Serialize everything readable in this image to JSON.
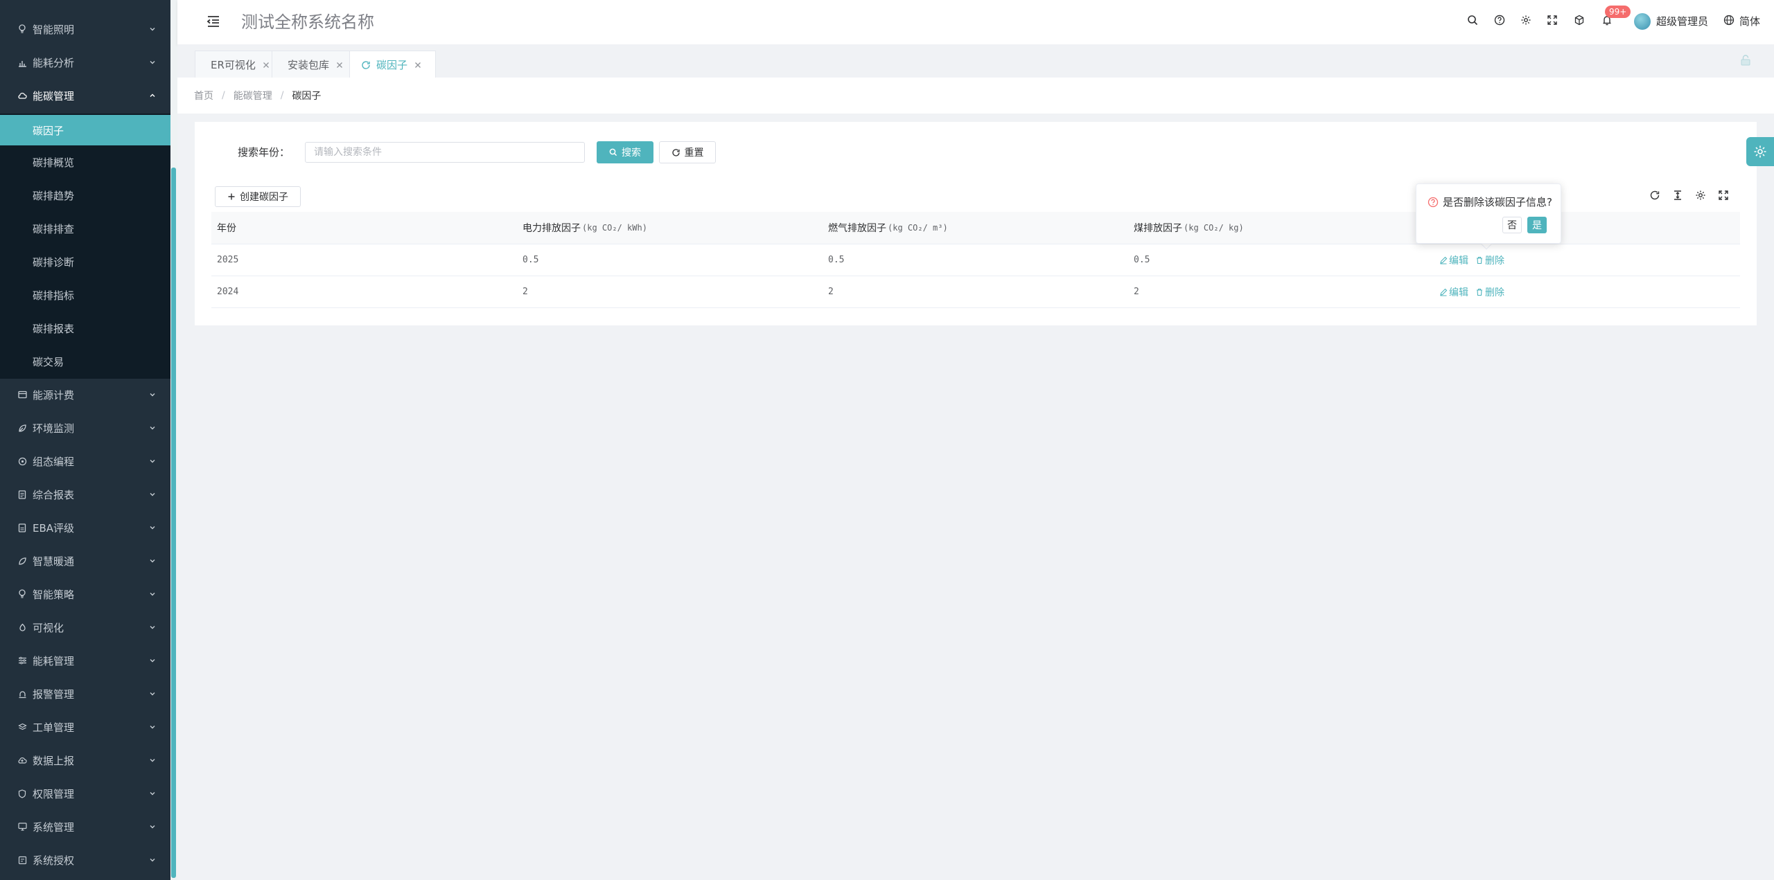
{
  "app": {
    "title": "测试全称系统名称"
  },
  "colors": {
    "primary": "#4fb4bd",
    "sidebar_bg": "#22303c",
    "submenu_bg": "#0f1c26",
    "badge": "#f56c6c"
  },
  "sidebar": {
    "items_top": [
      {
        "label": "智能照明",
        "icon": "bulb-icon"
      },
      {
        "label": "能耗分析",
        "icon": "chart-icon"
      },
      {
        "label": "能碳管理",
        "icon": "cloud-icon",
        "open": true
      }
    ],
    "submenu": [
      {
        "label": "碳因子",
        "active": true
      },
      {
        "label": "碳排概览"
      },
      {
        "label": "碳排趋势"
      },
      {
        "label": "碳排排查"
      },
      {
        "label": "碳排诊断"
      },
      {
        "label": "碳排指标"
      },
      {
        "label": "碳排报表"
      },
      {
        "label": "碳交易"
      }
    ],
    "items_bottom": [
      {
        "label": "能源计费",
        "icon": "billing-icon"
      },
      {
        "label": "环境监测",
        "icon": "leaf-icon"
      },
      {
        "label": "组态编程",
        "icon": "config-icon"
      },
      {
        "label": "综合报表",
        "icon": "report-icon"
      },
      {
        "label": "EBA评级",
        "icon": "rating-icon"
      },
      {
        "label": "智慧暖通",
        "icon": "hvac-icon"
      },
      {
        "label": "智能策略",
        "icon": "strategy-icon"
      },
      {
        "label": "可视化",
        "icon": "visual-icon"
      },
      {
        "label": "能耗管理",
        "icon": "sliders-icon"
      },
      {
        "label": "报警管理",
        "icon": "alarm-icon"
      },
      {
        "label": "工单管理",
        "icon": "layers-icon"
      },
      {
        "label": "数据上报",
        "icon": "upload-icon"
      },
      {
        "label": "权限管理",
        "icon": "shield-icon"
      },
      {
        "label": "系统管理",
        "icon": "monitor-icon"
      },
      {
        "label": "系统授权",
        "icon": "license-icon"
      }
    ]
  },
  "header": {
    "icons": [
      "search-icon",
      "help-icon",
      "gear-icon",
      "fullscreen-icon",
      "box-icon",
      "bell-icon"
    ],
    "badge": "99+",
    "user_name": "超级管理员",
    "language": "简体"
  },
  "tabs": [
    {
      "label": "ER可视化",
      "active": false
    },
    {
      "label": "安装包库",
      "active": false
    },
    {
      "label": "碳因子",
      "active": true
    }
  ],
  "breadcrumb": [
    "首页",
    "能碳管理",
    "碳因子"
  ],
  "search": {
    "label": "搜索年份：",
    "placeholder": "请输入搜索条件",
    "value": "",
    "search_label": "搜索",
    "reset_label": "重置"
  },
  "toolbar": {
    "create_label": "创建碳因子"
  },
  "table": {
    "columns": [
      {
        "label": "年份",
        "unit": ""
      },
      {
        "label": "电力排放因子",
        "unit": "(kg CO₂/ kWh)"
      },
      {
        "label": "燃气排放因子",
        "unit": "(kg CO₂/ m³)"
      },
      {
        "label": "煤排放因子",
        "unit": "(kg CO₂/ kg)"
      },
      {
        "label": "",
        "unit": ""
      }
    ],
    "rows": [
      {
        "year": "2025",
        "electric": "0.5",
        "gas": "0.5",
        "coal": "0.5"
      },
      {
        "year": "2024",
        "electric": "2",
        "gas": "2",
        "coal": "2"
      }
    ],
    "actions": {
      "edit": "编辑",
      "delete": "删除"
    }
  },
  "popconfirm": {
    "text": "是否删除该碳因子信息?",
    "no": "否",
    "yes": "是"
  }
}
